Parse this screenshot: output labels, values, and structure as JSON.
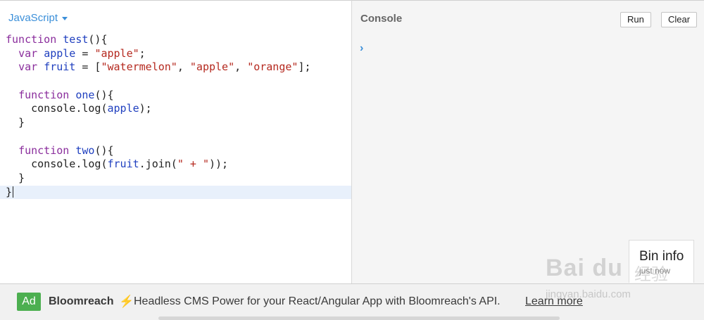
{
  "editor": {
    "language": "JavaScript",
    "code_lines": [
      "function test(){",
      "  var apple = \"apple\";",
      "  var fruit = [\"watermelon\", \"apple\", \"orange\"];",
      "",
      "  function one(){",
      "    console.log(apple);",
      "  }",
      "",
      "  function two(){",
      "    console.log(fruit.join(\" + \"));",
      "  }",
      "}"
    ]
  },
  "console": {
    "title": "Console",
    "run_label": "Run",
    "clear_label": "Clear",
    "prompt": "›"
  },
  "bin_info": {
    "title": "Bin info",
    "subtitle": "just now"
  },
  "ad": {
    "badge": "Ad",
    "brand": "Bloomreach",
    "bolt": "⚡",
    "text": "Headless CMS Power for your React/Angular App with Bloomreach's API.",
    "link": "Learn more"
  },
  "watermark": {
    "logo": "Bai du",
    "cn": "经验",
    "url": "jingyan.baidu.com"
  }
}
